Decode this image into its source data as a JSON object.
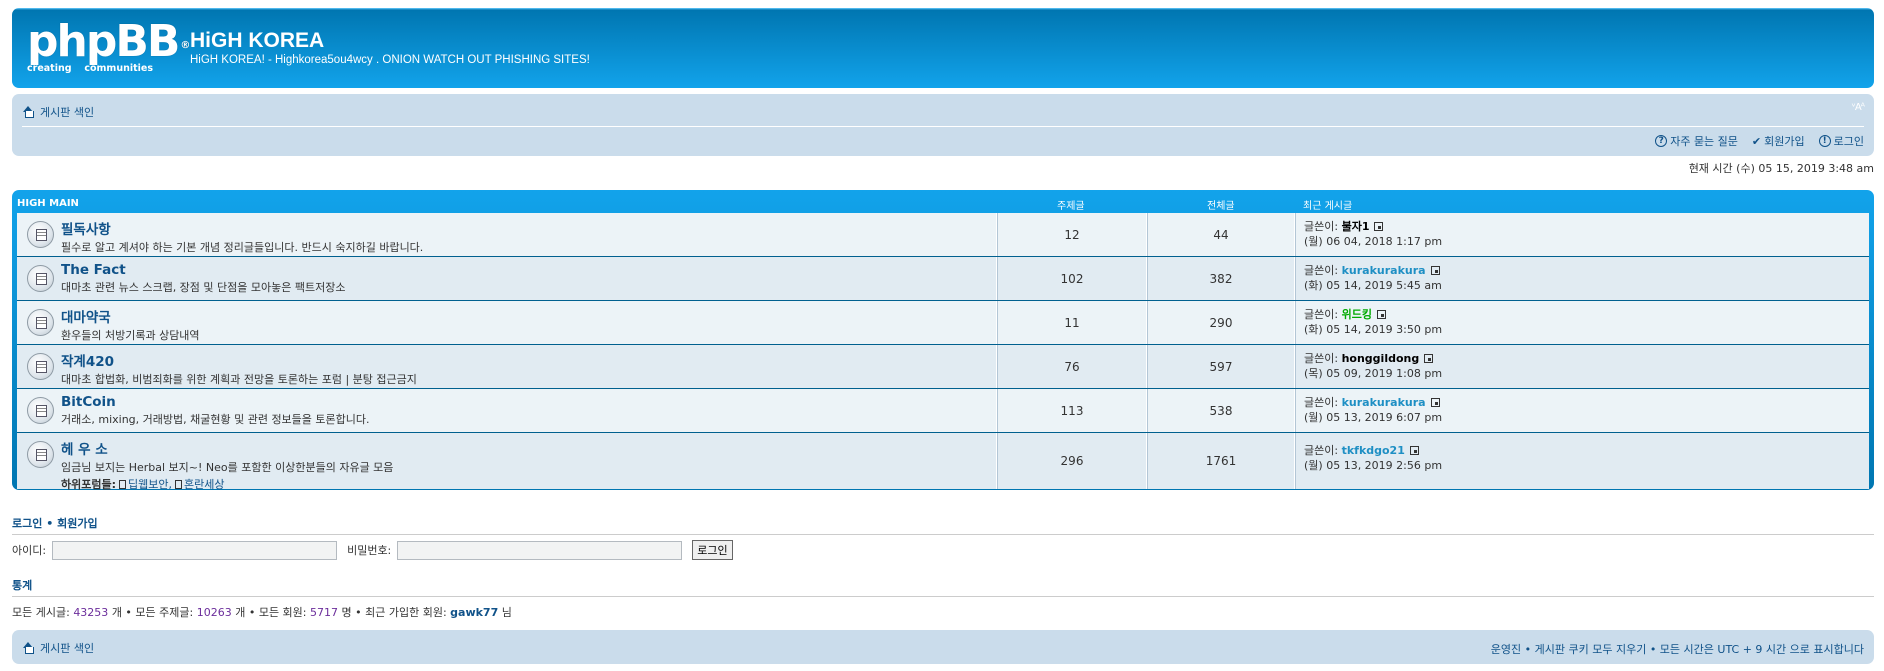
{
  "header": {
    "logo_text": "phpBB",
    "logo_reg": "®",
    "logo_sub_left": "creating",
    "logo_sub_right": "communities",
    "site_title": "HiGH KOREA",
    "site_desc": "HiGH KOREA! - Highkorea5ou4wcy . ONION WATCH OUT PHISHING SITES!"
  },
  "navbar": {
    "index_label": "게시판 색인",
    "font_control": "ᵛAᴬ",
    "faq_label": "자주 묻는 질문",
    "register_label": "회원가입",
    "login_label": "로그인"
  },
  "current_time": "현재 시간 (수) 05 15, 2019 3:48 am",
  "forum_table": {
    "header_name": "HIGH MAIN",
    "header_topics": "주제글",
    "header_posts": "전체글",
    "header_last": "최근 게시글",
    "rows": [
      {
        "title": "필독사항",
        "desc": "필수로 알고 계셔야 하는 기본 개념 정리글들입니다. 반드시 숙지하길 바랍니다.",
        "topics": "12",
        "posts": "44",
        "by": "글쓴이:",
        "author": "불자1",
        "date": "(월) 06 04, 2018 1:17 pm"
      },
      {
        "title": "The Fact",
        "desc": "대마초 관련 뉴스 스크랩, 장점 및 단점을 모아놓은 팩트저장소",
        "topics": "102",
        "posts": "382",
        "by": "글쓴이:",
        "author": "kurakurakura",
        "date": "(화) 05 14, 2019 5:45 am"
      },
      {
        "title": "대마약국",
        "desc": "환우들의 처방기록과 상담내역",
        "topics": "11",
        "posts": "290",
        "by": "글쓴이:",
        "author": "위드킹",
        "date": "(화) 05 14, 2019 3:50 pm"
      },
      {
        "title": "작계420",
        "desc": "대마초 합법화, 비범죄화를 위한 계획과 전망을 토론하는 포럼 | 분탕 접근금지",
        "topics": "76",
        "posts": "597",
        "by": "글쓴이:",
        "author": "honggildong",
        "date": "(목) 05 09, 2019 1:08 pm"
      },
      {
        "title": "BitCoin",
        "desc": "거래소, mixing, 거래방법, 채굴현황 및 관련 정보들을 토론합니다.",
        "topics": "113",
        "posts": "538",
        "by": "글쓴이:",
        "author": "kurakurakura",
        "date": "(월) 05 13, 2019 6:07 pm"
      },
      {
        "title": "헤 우 소",
        "desc": "임금님 보지는 Herbal 보지~! Neo를 포함한 이상한분들의 자유글 모음",
        "subforums_label": "하위포럼들:",
        "subforum_1": "딥웹보안,",
        "subforum_2": "혼란세상",
        "topics": "296",
        "posts": "1761",
        "by": "글쓴이:",
        "author": "tkfkdgo21",
        "date": "(월) 05 13, 2019 2:56 pm"
      }
    ]
  },
  "login": {
    "title_login": "로그인",
    "title_sep": "•",
    "title_register": "회원가입",
    "id_label": "아이디:",
    "id_value": "",
    "pw_label": "비밀번호:",
    "pw_value": "",
    "button": "로그인"
  },
  "stats": {
    "title": "통계",
    "posts_label": "모든 게시글:",
    "posts_value": "43253",
    "posts_unit": "개 • 모든 주제글:",
    "topics_value": "10263",
    "topics_unit": "개 • 모든 회원:",
    "members_value": "5717",
    "members_unit": "명 • 최근 가입한 회원:",
    "newest": "gawk77",
    "newest_suffix": "님"
  },
  "footer": {
    "index_label": "게시판 색인",
    "right_text": "운영진 • 게시판 쿠키 모두 지우기 • 모든 시간은 UTC + 9 시간 으로 표시합니다"
  },
  "colors": {
    "header_blue": "#0076B1",
    "nav_bg": "#CADCEB",
    "link": "#105289",
    "author_cyan": "#1e8fc4",
    "author_green": "#00AA00"
  }
}
